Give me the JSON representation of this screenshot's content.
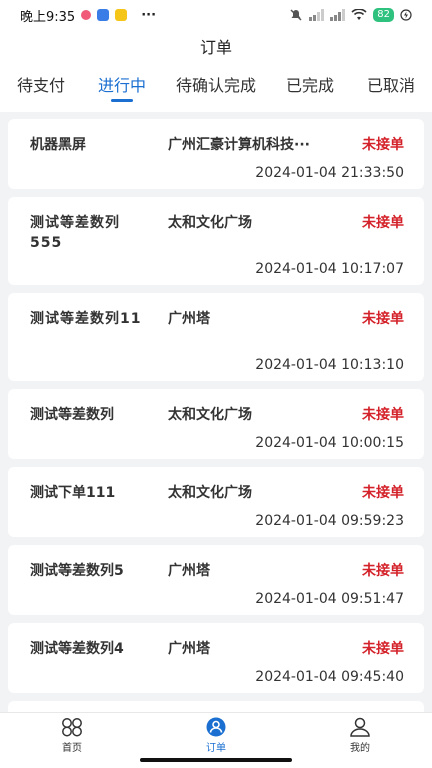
{
  "status_bar": {
    "time": "晚上9:35",
    "dots": "···",
    "battery": "82"
  },
  "title": "订单",
  "tabs": [
    {
      "label": "待支付"
    },
    {
      "label": "进行中"
    },
    {
      "label": "待确认完成"
    },
    {
      "label": "已完成"
    },
    {
      "label": "已取消"
    }
  ],
  "orders": [
    {
      "name": "机器黑屏",
      "location": "广州汇豪计算机科技···",
      "status": "未接单",
      "time": "2024-01-04 21:33:50"
    },
    {
      "name": "测试等差数列555",
      "location": "太和文化广场",
      "status": "未接单",
      "time": "2024-01-04 10:17:07"
    },
    {
      "name": "测试等差数列11",
      "location": "广州塔",
      "status": "未接单",
      "time": "2024-01-04 10:13:10"
    },
    {
      "name": "测试等差数列",
      "location": "太和文化广场",
      "status": "未接单",
      "time": "2024-01-04 10:00:15"
    },
    {
      "name": "测试下单111",
      "location": "太和文化广场",
      "status": "未接单",
      "time": "2024-01-04 09:59:23"
    },
    {
      "name": "测试等差数列5",
      "location": "广州塔",
      "status": "未接单",
      "time": "2024-01-04 09:51:47"
    },
    {
      "name": "测试等差数列4",
      "location": "广州塔",
      "status": "未接单",
      "time": "2024-01-04 09:45:40"
    }
  ],
  "nav": [
    {
      "label": "首页",
      "icon": "home-grid-icon"
    },
    {
      "label": "订单",
      "icon": "order-person-icon"
    },
    {
      "label": "我的",
      "icon": "profile-icon"
    }
  ],
  "colors": {
    "accent": "#1a6fd1",
    "status_red": "#d4222a"
  }
}
